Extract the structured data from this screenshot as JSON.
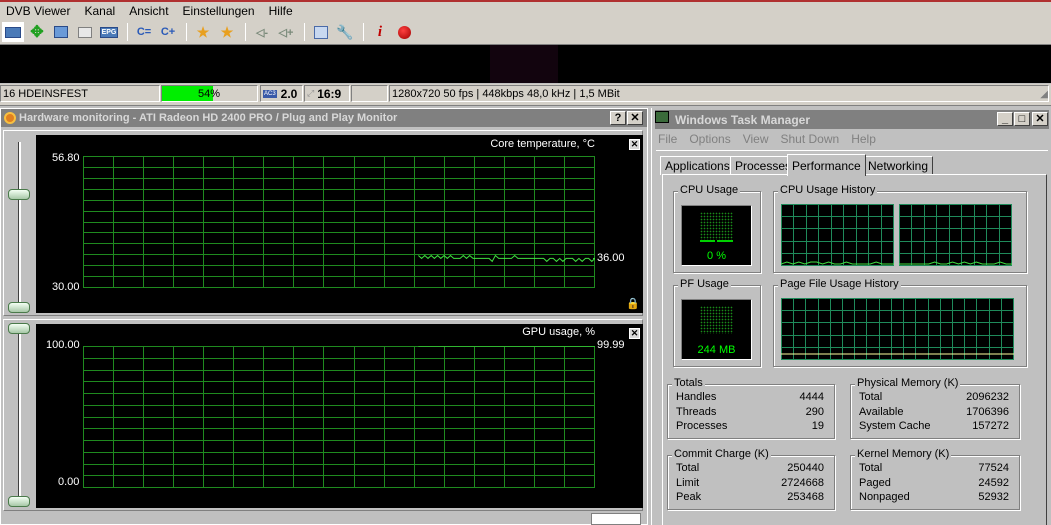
{
  "dvb": {
    "menu": [
      "DVB Viewer",
      "Kanal",
      "Ansicht",
      "Einstellungen",
      "Hilfe"
    ],
    "toolbar_icons": [
      "display-mode-icon",
      "fullscreen-move-icon",
      "osd-icon",
      "teletext-icon",
      "epg-icon",
      "channel-prev-icon",
      "channel-next-icon",
      "favorite-prev-icon",
      "favorite-next-icon",
      "volume-down-icon",
      "volume-up-icon",
      "recording-list-icon",
      "settings-wrench-icon",
      "info-icon",
      "record-icon"
    ],
    "toolbar_epg_label": "EPG",
    "status": {
      "channel": "16 HDEINSFEST",
      "signal_percent": 54,
      "signal_label": "54%",
      "audio_format": "AC3",
      "audio_channels": "2.0",
      "aspect_ratio": "16:9",
      "stream_info": "1280x720 50 fps | 448kbps 48,0 kHz | 1,5 MBit"
    }
  },
  "hw_monitor": {
    "title": "Hardware monitoring - ATI Radeon HD 2400 PRO / Plug and Play Monitor",
    "help_label": "?",
    "close_label": "✕",
    "graphs": [
      {
        "title": "Core temperature, °C",
        "y_max_label": "56.80",
        "y_min_label": "30.00",
        "current_label": "36.00",
        "ymin": 30.0,
        "ymax": 56.8,
        "current": 36.0
      },
      {
        "title": "GPU usage, %",
        "y_max_label": "100.00",
        "y_min_label": "0.00",
        "current_label": "99.99",
        "ymin": 0,
        "ymax": 100,
        "current": 99.99
      }
    ]
  },
  "chart_data": [
    {
      "type": "line",
      "title": "Core temperature, °C",
      "ylim": [
        30.0,
        56.8
      ],
      "grid": true,
      "series": [
        {
          "name": "Core temperature",
          "values": [
            36.6,
            36.0,
            36.6,
            36.0,
            36.6,
            36.0,
            36.6,
            36.0,
            36.6,
            36.0,
            36.6,
            36.0,
            36.0,
            36.0,
            36.6,
            36.0,
            36.6,
            36.0,
            36.0,
            36.0,
            36.0,
            36.0,
            36.0,
            35.4,
            36.6,
            36.0,
            36.0,
            36.0,
            36.0,
            36.0,
            36.6,
            36.0,
            36.0,
            36.0,
            36.0,
            36.0,
            36.0,
            36.0,
            36.0,
            36.0,
            35.4,
            36.0,
            36.0,
            35.4,
            36.0,
            35.4,
            36.0,
            36.0,
            36.0,
            35.4,
            36.0,
            35.4,
            36.0,
            36.0,
            35.4,
            36.0
          ]
        }
      ],
      "current": 36.0
    },
    {
      "type": "line",
      "title": "GPU usage, %",
      "ylim": [
        0,
        100
      ],
      "grid": true,
      "series": [
        {
          "name": "GPU usage",
          "values": [
            99.99,
            99.99,
            99.99,
            99.99,
            99.99,
            99.99,
            99.99,
            99.99,
            99.99,
            99.99
          ]
        }
      ],
      "current": 99.99
    }
  ],
  "task_manager": {
    "title": "Windows Task Manager",
    "menu": [
      "File",
      "Options",
      "View",
      "Shut Down",
      "Help"
    ],
    "tabs": [
      "Applications",
      "Processes",
      "Performance",
      "Networking"
    ],
    "active_tab": "Performance",
    "cpu_usage": {
      "label": "CPU Usage",
      "value": "0 %",
      "percent": 0
    },
    "cpu_history_label": "CPU Usage History",
    "pf_usage": {
      "label": "PF Usage",
      "value": "244 MB"
    },
    "pf_history_label": "Page File Usage History",
    "totals": {
      "label": "Totals",
      "rows": [
        {
          "k": "Handles",
          "v": "4444"
        },
        {
          "k": "Threads",
          "v": "290"
        },
        {
          "k": "Processes",
          "v": "19"
        }
      ]
    },
    "physical_memory": {
      "label": "Physical Memory (K)",
      "rows": [
        {
          "k": "Total",
          "v": "2096232"
        },
        {
          "k": "Available",
          "v": "1706396"
        },
        {
          "k": "System Cache",
          "v": "157272"
        }
      ]
    },
    "commit_charge": {
      "label": "Commit Charge (K)",
      "rows": [
        {
          "k": "Total",
          "v": "250440"
        },
        {
          "k": "Limit",
          "v": "2724668"
        },
        {
          "k": "Peak",
          "v": "253468"
        }
      ]
    },
    "kernel_memory": {
      "label": "Kernel Memory (K)",
      "rows": [
        {
          "k": "Total",
          "v": "77524"
        },
        {
          "k": "Paged",
          "v": "24592"
        },
        {
          "k": "Nonpaged",
          "v": "52932"
        }
      ]
    },
    "minimize_label": "_",
    "maximize_label": "□",
    "close_label": "✕"
  }
}
